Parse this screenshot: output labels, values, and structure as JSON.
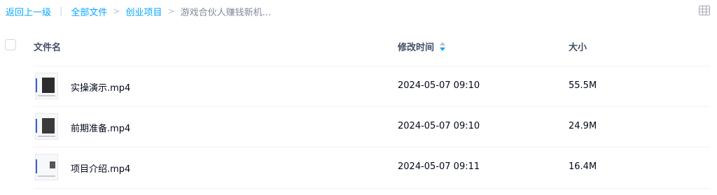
{
  "breadcrumb": {
    "back": "返回上一级",
    "separator": "|",
    "gt": ">",
    "all_files": "全部文件",
    "folder": "创业项目",
    "current": "游戏合伙人赚钱新机..."
  },
  "table": {
    "headers": {
      "name": "文件名",
      "modified": "修改时间",
      "size": "大小"
    },
    "rows": [
      {
        "name": "实操演示.mp4",
        "modified": "2024-05-07 09:10",
        "size": "55.5M"
      },
      {
        "name": "前期准备.mp4",
        "modified": "2024-05-07 09:10",
        "size": "24.9M"
      },
      {
        "name": "项目介绍.mp4",
        "modified": "2024-05-07 09:11",
        "size": "16.4M"
      }
    ]
  },
  "icons": {
    "view_toggle": "grid-view-icon",
    "sort": "sort-icon",
    "thumbnail": "video-thumbnail-icon"
  },
  "colors": {
    "link": "#06a7ff",
    "muted": "#818999",
    "header_text": "#424e67",
    "text": "#03081a",
    "sort_active": "#06a7ff"
  }
}
